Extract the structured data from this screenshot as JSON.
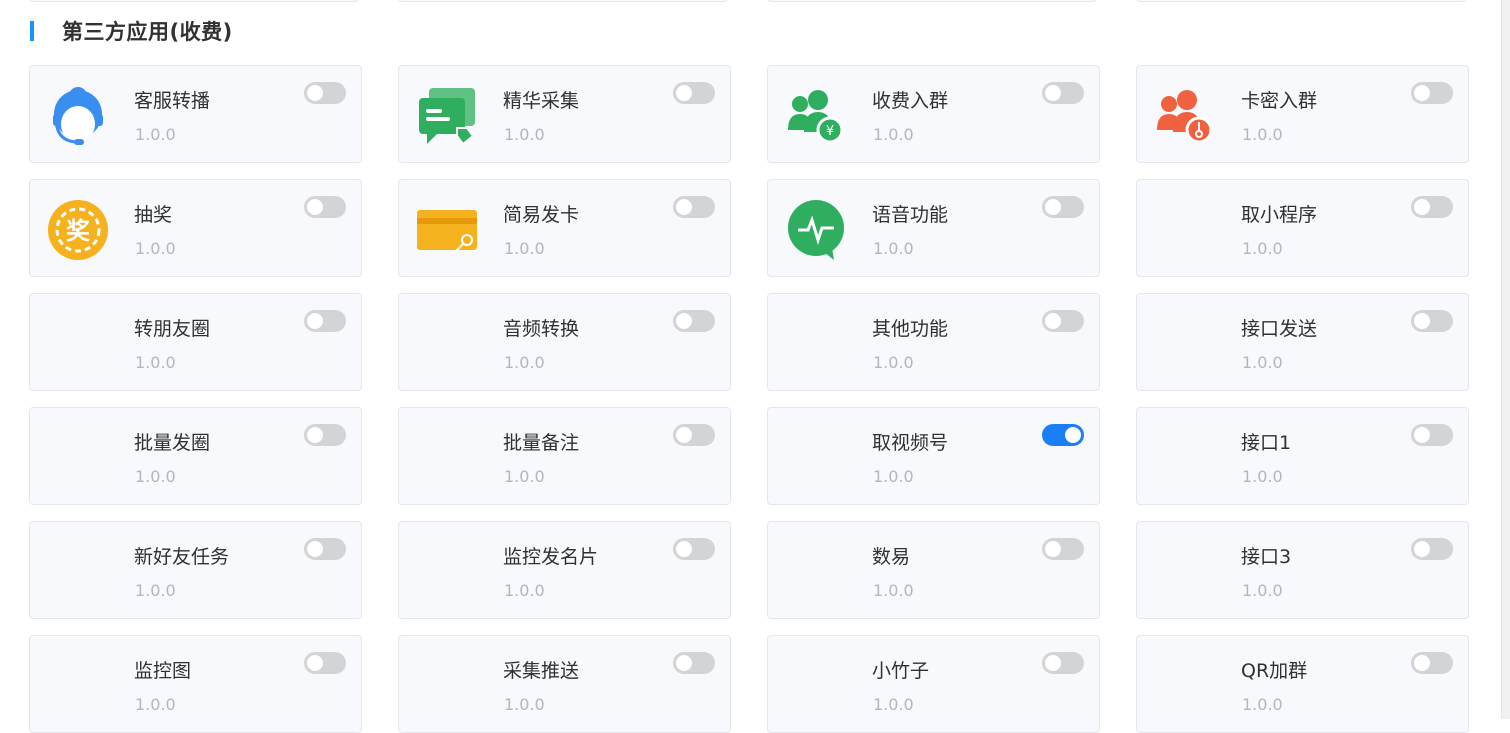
{
  "section": {
    "title": "第三方应用(收费)"
  },
  "colors": {
    "accent": "#1890ff",
    "toggle_on": "#1a7ff5",
    "toggle_off": "#d3d4d6"
  },
  "apps": [
    {
      "name": "客服转播",
      "version": "1.0.0",
      "enabled": false,
      "icon": "customer-service-icon",
      "icon_color": "#3a8ef0"
    },
    {
      "name": "精华采集",
      "version": "1.0.0",
      "enabled": false,
      "icon": "message-collect-icon",
      "icon_color": "#2eae5e"
    },
    {
      "name": "收费入群",
      "version": "1.0.0",
      "enabled": false,
      "icon": "paid-group-icon",
      "icon_color": "#2eae5e"
    },
    {
      "name": "卡密入群",
      "version": "1.0.0",
      "enabled": false,
      "icon": "card-key-group-icon",
      "icon_color": "#f0613f"
    },
    {
      "name": "抽奖",
      "version": "1.0.0",
      "enabled": false,
      "icon": "lottery-icon",
      "icon_color": "#f5b21e"
    },
    {
      "name": "简易发卡",
      "version": "1.0.0",
      "enabled": false,
      "icon": "card-issue-icon",
      "icon_color": "#f5b21e"
    },
    {
      "name": "语音功能",
      "version": "1.0.0",
      "enabled": false,
      "icon": "voice-chat-icon",
      "icon_color": "#2eae5e"
    },
    {
      "name": "取小程序",
      "version": "1.0.0",
      "enabled": false,
      "icon": null
    },
    {
      "name": "转朋友圈",
      "version": "1.0.0",
      "enabled": false,
      "icon": null
    },
    {
      "name": "音频转换",
      "version": "1.0.0",
      "enabled": false,
      "icon": null
    },
    {
      "name": "其他功能",
      "version": "1.0.0",
      "enabled": false,
      "icon": null
    },
    {
      "name": "接口发送",
      "version": "1.0.0",
      "enabled": false,
      "icon": null
    },
    {
      "name": "批量发圈",
      "version": "1.0.0",
      "enabled": false,
      "icon": null
    },
    {
      "name": "批量备注",
      "version": "1.0.0",
      "enabled": false,
      "icon": null
    },
    {
      "name": "取视频号",
      "version": "1.0.0",
      "enabled": true,
      "icon": null
    },
    {
      "name": "接口1",
      "version": "1.0.0",
      "enabled": false,
      "icon": null
    },
    {
      "name": "新好友任务",
      "version": "1.0.0",
      "enabled": false,
      "icon": null
    },
    {
      "name": "监控发名片",
      "version": "1.0.0",
      "enabled": false,
      "icon": null
    },
    {
      "name": "数易",
      "version": "1.0.0",
      "enabled": false,
      "icon": null
    },
    {
      "name": "接口3",
      "version": "1.0.0",
      "enabled": false,
      "icon": null
    },
    {
      "name": "监控图",
      "version": "1.0.0",
      "enabled": false,
      "icon": null
    },
    {
      "name": "采集推送",
      "version": "1.0.0",
      "enabled": false,
      "icon": null
    },
    {
      "name": "小竹子",
      "version": "1.0.0",
      "enabled": false,
      "icon": null
    },
    {
      "name": "QR加群",
      "version": "1.0.0",
      "enabled": false,
      "icon": null
    }
  ]
}
